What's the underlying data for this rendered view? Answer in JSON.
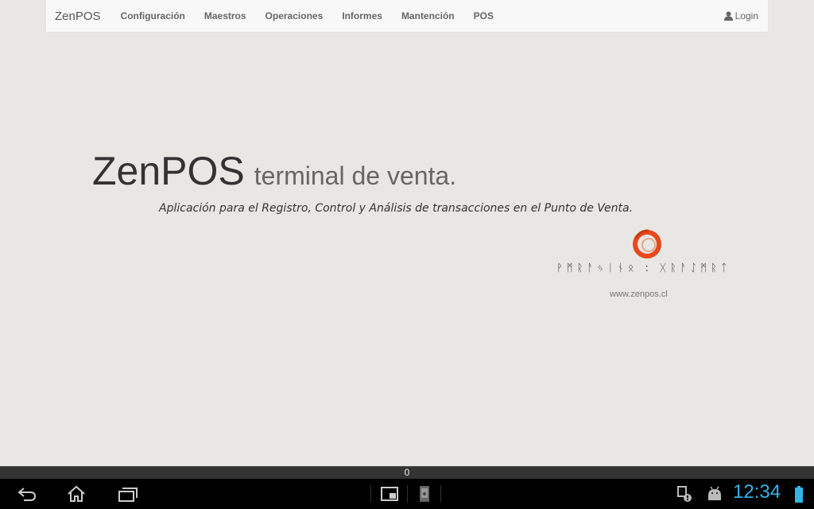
{
  "navbar": {
    "brand": "ZenPOS",
    "items": [
      "Configuración",
      "Maestros",
      "Operaciones",
      "Informes",
      "Mantención",
      "POS"
    ],
    "login": "Login"
  },
  "hero": {
    "title": "ZenPOS",
    "subtitle": "terminal de venta.",
    "tagline": "Aplicación para el Registro, Control y Análisis de transacciones en el Punto de Venta.",
    "website": "www.zenpos.cl"
  },
  "logo": {
    "accent_color": "#e8491d"
  },
  "system_bar": {
    "notification_count": "0",
    "clock": "12:34",
    "accent_color": "#33b5e5"
  }
}
